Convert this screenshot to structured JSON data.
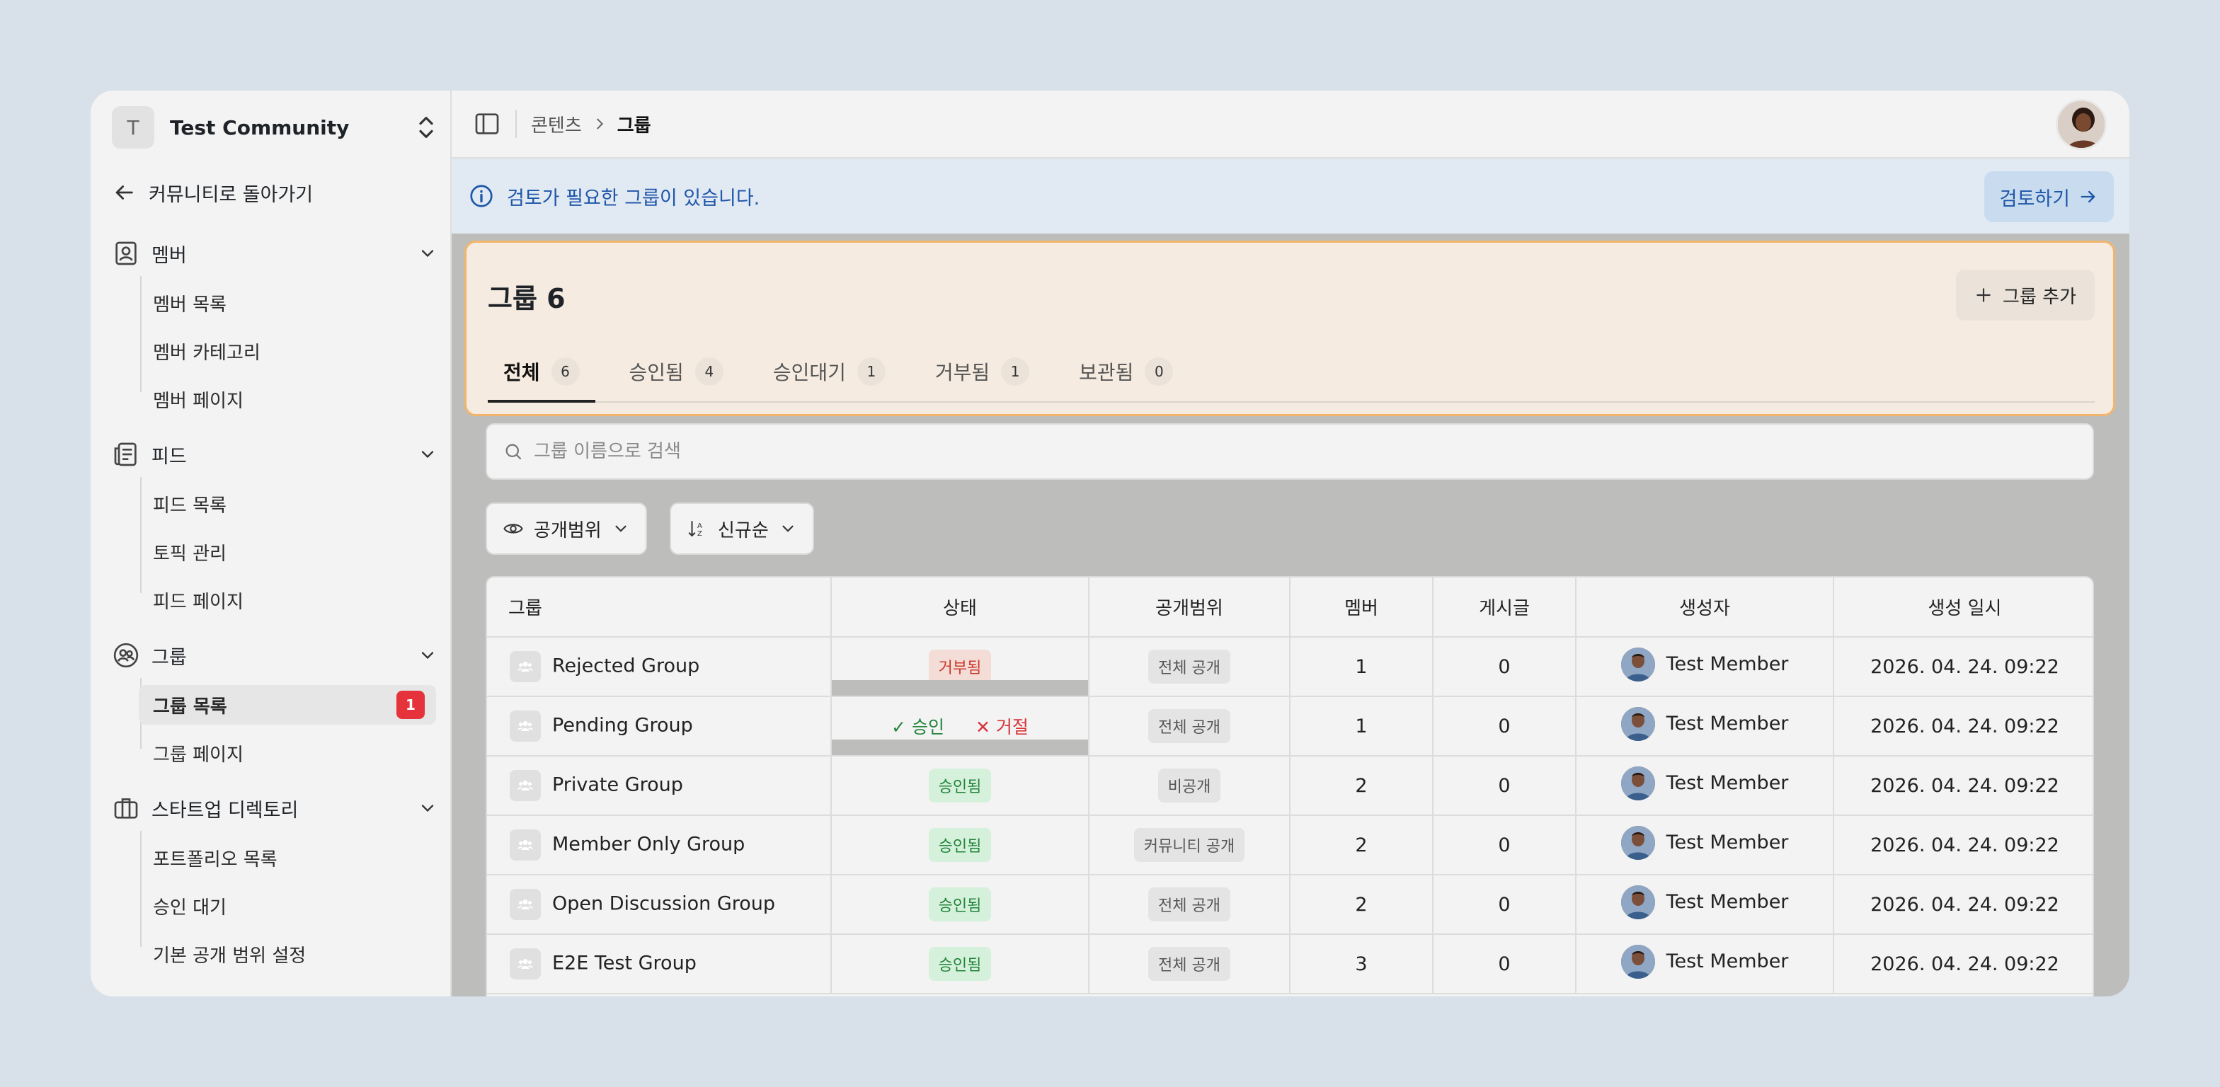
{
  "community": {
    "initial": "T",
    "name": "Test Community"
  },
  "sidebar": {
    "back_label": "커뮤니티로 돌아가기",
    "sections": [
      {
        "label": "멤버",
        "items": [
          "멤버 목록",
          "멤버 카테고리",
          "멤버 페이지"
        ]
      },
      {
        "label": "피드",
        "items": [
          "피드 목록",
          "토픽 관리",
          "피드 페이지"
        ]
      },
      {
        "label": "그룹",
        "items": [
          "그룹 목록",
          "그룹 페이지"
        ],
        "active_item": "그룹 목록",
        "active_badge": "1"
      },
      {
        "label": "스타트업 디렉토리",
        "items": [
          "포트폴리오 목록",
          "승인 대기",
          "기본 공개 범위 설정"
        ]
      }
    ]
  },
  "breadcrumb": {
    "parent": "콘텐츠",
    "current": "그룹"
  },
  "alert": {
    "text": "검토가 필요한 그룹이 있습니다.",
    "button": "검토하기"
  },
  "page": {
    "title": "그룹 6",
    "add_button": "그룹 추가"
  },
  "tabs": [
    {
      "label": "전체",
      "count": "6"
    },
    {
      "label": "승인됨",
      "count": "4"
    },
    {
      "label": "승인대기",
      "count": "1"
    },
    {
      "label": "거부됨",
      "count": "1"
    },
    {
      "label": "보관됨",
      "count": "0"
    }
  ],
  "search": {
    "placeholder": "그룹 이름으로 검색"
  },
  "filters": {
    "visibility": "공개범위",
    "sort": "신규순"
  },
  "table": {
    "columns": [
      "그룹",
      "상태",
      "공개범위",
      "멤버",
      "게시글",
      "생성자",
      "생성 일시"
    ],
    "actions": {
      "approve": "승인",
      "reject": "거절"
    },
    "rows": [
      {
        "name": "Rejected Group",
        "status": "거부됨",
        "status_type": "rejected",
        "visibility": "전체 공개",
        "members": "1",
        "posts": "0",
        "creator": "Test Member",
        "created": "2026. 04. 24. 09:22"
      },
      {
        "name": "Pending Group",
        "status": "",
        "status_type": "pending",
        "visibility": "전체 공개",
        "members": "1",
        "posts": "0",
        "creator": "Test Member",
        "created": "2026. 04. 24. 09:22"
      },
      {
        "name": "Private Group",
        "status": "승인됨",
        "status_type": "approved",
        "visibility": "비공개",
        "members": "2",
        "posts": "0",
        "creator": "Test Member",
        "created": "2026. 04. 24. 09:22"
      },
      {
        "name": "Member Only Group",
        "status": "승인됨",
        "status_type": "approved",
        "visibility": "커뮤니티 공개",
        "members": "2",
        "posts": "0",
        "creator": "Test Member",
        "created": "2026. 04. 24. 09:22"
      },
      {
        "name": "Open Discussion Group",
        "status": "승인됨",
        "status_type": "approved",
        "visibility": "전체 공개",
        "members": "2",
        "posts": "0",
        "creator": "Test Member",
        "created": "2026. 04. 24. 09:22"
      },
      {
        "name": "E2E Test Group",
        "status": "승인됨",
        "status_type": "approved",
        "visibility": "전체 공개",
        "members": "3",
        "posts": "0",
        "creator": "Test Member",
        "created": "2026. 04. 24. 09:22"
      }
    ]
  },
  "colors": {
    "accent": "#1e56a8",
    "approved": "#23843a",
    "rejected": "#d6343b",
    "highlight_border": "#f2b56b"
  }
}
